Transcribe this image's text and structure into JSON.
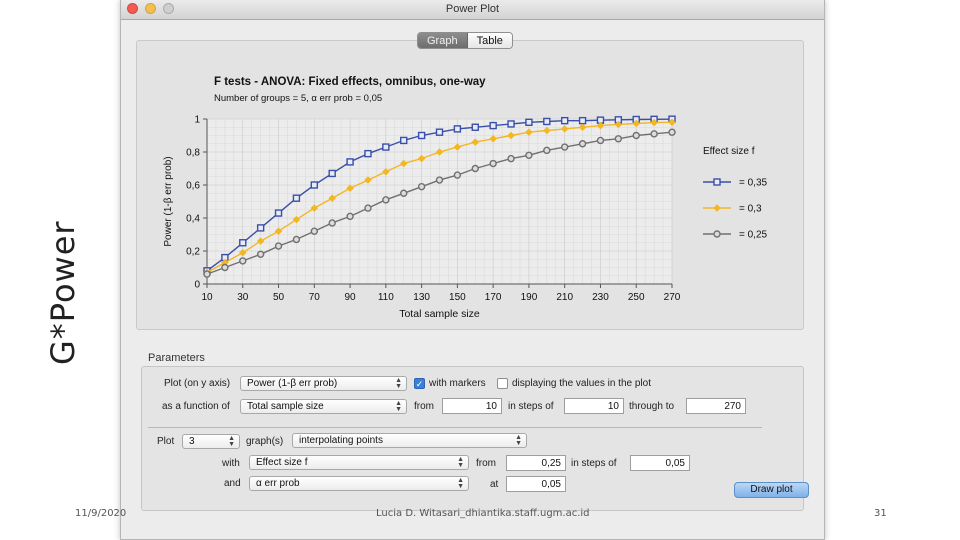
{
  "slide": {
    "side_title": "G*Power",
    "footer_date": "11/9/2020",
    "footer_center": "Lucia D. Witasari_dhiantika.staff.ugm.ac.id",
    "footer_page": "31"
  },
  "window": {
    "title": "Power Plot",
    "tabs": [
      {
        "label": "Graph",
        "active": true
      },
      {
        "label": "Table",
        "active": false
      }
    ]
  },
  "chart_data": {
    "type": "line",
    "title": "F tests - ANOVA: Fixed effects, omnibus, one-way",
    "subtitle": "Number of groups = 5, α err prob = 0,05",
    "xlabel": "Total sample size",
    "ylabel": "Power (1-β err prob)",
    "xlim": [
      10,
      270
    ],
    "ylim": [
      0,
      1
    ],
    "x_ticks": [
      "10",
      "30",
      "50",
      "70",
      "90",
      "110",
      "130",
      "150",
      "170",
      "190",
      "210",
      "230",
      "250",
      "270"
    ],
    "y_ticks": [
      "0",
      "0,2",
      "0,4",
      "0,6",
      "0,8",
      "1"
    ],
    "grid": true,
    "legend_title": "Effect size f",
    "legend_position": "right",
    "x": [
      10,
      20,
      30,
      40,
      50,
      60,
      70,
      80,
      90,
      100,
      110,
      120,
      130,
      140,
      150,
      160,
      170,
      180,
      190,
      200,
      210,
      220,
      230,
      240,
      250,
      260,
      270
    ],
    "series": [
      {
        "name": "= 0,35",
        "color": "#3a4fa8",
        "marker": "square",
        "values": [
          0.08,
          0.16,
          0.25,
          0.34,
          0.43,
          0.52,
          0.6,
          0.67,
          0.74,
          0.79,
          0.83,
          0.87,
          0.9,
          0.92,
          0.94,
          0.95,
          0.96,
          0.97,
          0.98,
          0.985,
          0.99,
          0.99,
          0.993,
          0.995,
          0.997,
          0.998,
          0.999
        ]
      },
      {
        "name": "= 0,3",
        "color": "#f2b722",
        "marker": "diamond",
        "values": [
          0.07,
          0.13,
          0.19,
          0.26,
          0.32,
          0.39,
          0.46,
          0.52,
          0.58,
          0.63,
          0.68,
          0.73,
          0.76,
          0.8,
          0.83,
          0.86,
          0.88,
          0.9,
          0.92,
          0.93,
          0.94,
          0.95,
          0.96,
          0.967,
          0.973,
          0.978,
          0.98
        ]
      },
      {
        "name": "= 0,25",
        "color": "#707070",
        "marker": "circle",
        "values": [
          0.06,
          0.1,
          0.14,
          0.18,
          0.23,
          0.27,
          0.32,
          0.37,
          0.41,
          0.46,
          0.51,
          0.55,
          0.59,
          0.63,
          0.66,
          0.7,
          0.73,
          0.76,
          0.78,
          0.81,
          0.83,
          0.85,
          0.87,
          0.88,
          0.9,
          0.91,
          0.92
        ]
      }
    ]
  },
  "parameters": {
    "section_label": "Parameters",
    "plot_on_y_label": "Plot (on y axis)",
    "plot_on_y_value": "Power (1-β err prob)",
    "with_markers_label": "with markers",
    "with_markers_checked": true,
    "display_values_label": "displaying the values in the plot",
    "display_values_checked": false,
    "function_of_label": "as a function of",
    "function_of_value": "Total sample size",
    "from_label": "from",
    "from_value": "10",
    "steps_label": "in steps of",
    "steps_value": "10",
    "through_label": "through to",
    "through_value": "270",
    "plot_label": "Plot",
    "plot_count": "3",
    "graphs_label": "graph(s)",
    "graph_mode": "interpolating points",
    "with_label": "with",
    "with_value": "Effect size f",
    "with_from_label": "from",
    "with_from_value": "0,25",
    "with_steps_label": "in steps of",
    "with_steps_value": "0,05",
    "and_label": "and",
    "and_value": "α err prob",
    "at_label": "at",
    "at_value": "0,05",
    "draw_button": "Draw plot"
  }
}
